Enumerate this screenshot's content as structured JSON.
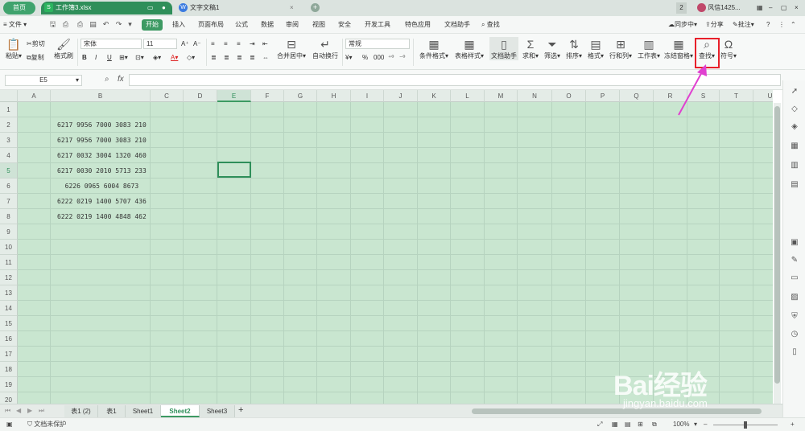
{
  "titlebar": {
    "home_tab": "首页",
    "doc_tab": "工作簿3.xlsx",
    "doc_tab2": "文字文稿1",
    "page_count": "2",
    "user": "风信1425...",
    "new_tab": "+"
  },
  "menubar": {
    "file": "文件",
    "tabs": [
      "开始",
      "插入",
      "页面布局",
      "公式",
      "数据",
      "审阅",
      "视图",
      "安全",
      "开发工具",
      "特色应用",
      "文档助手"
    ],
    "search": "查找",
    "sync": "同步中",
    "share": "分享",
    "comment": "批注"
  },
  "ribbon": {
    "paste": "粘贴",
    "cut": "剪切",
    "copy": "复制",
    "format_painter": "格式刷",
    "font_name": "宋体",
    "font_size": "11",
    "merge_center": "合并居中",
    "wrap_text": "自动换行",
    "number_format": "常规",
    "cond_format": "条件格式",
    "table_style": "表格样式",
    "doc_assist": "文档助手",
    "sum": "求和",
    "filter": "筛选",
    "sort": "排序",
    "format": "格式",
    "row_col": "行和列",
    "worksheet": "工作表",
    "freeze": "冻结窗格",
    "find": "查找",
    "symbol": "符号"
  },
  "formula_bar": {
    "cell_ref": "E5",
    "fx": "fx",
    "value": ""
  },
  "grid": {
    "columns": [
      "A",
      "B",
      "C",
      "D",
      "E",
      "F",
      "G",
      "H",
      "I",
      "J",
      "K",
      "L",
      "M",
      "N",
      "O",
      "P",
      "Q",
      "R",
      "S",
      "T",
      "U"
    ],
    "rows": [
      "1",
      "2",
      "3",
      "4",
      "5",
      "6",
      "7",
      "8",
      "9",
      "10",
      "11",
      "12",
      "13",
      "14",
      "15",
      "16",
      "17",
      "18",
      "19",
      "20"
    ],
    "selected_column": "E",
    "selected_row": "5",
    "cells_b": [
      "",
      "6217 9956 7000 3083 210",
      "6217 9956 7000 3083 210",
      "6217 0032 3004 1320 460",
      "6217 0030 2010 5713 233",
      "  6226 0965 6004 8673",
      "6222 0219 1400 5707 436",
      "6222 0219 1400 4848 462"
    ]
  },
  "sheets": {
    "tabs": [
      "表1 (2)",
      "表1",
      "Sheet1",
      "Sheet2",
      "Sheet3"
    ],
    "active": "Sheet2",
    "add": "+"
  },
  "statusbar": {
    "protect": "文档未保护",
    "zoom": "100%"
  },
  "watermark": {
    "main": "Bai经验",
    "sub": "jingyan.baidu.com"
  },
  "colors": {
    "accent": "#3d9a63",
    "grid_bg": "#c9e6d0",
    "highlight": "#e8202a",
    "arrow": "#e040d0"
  }
}
